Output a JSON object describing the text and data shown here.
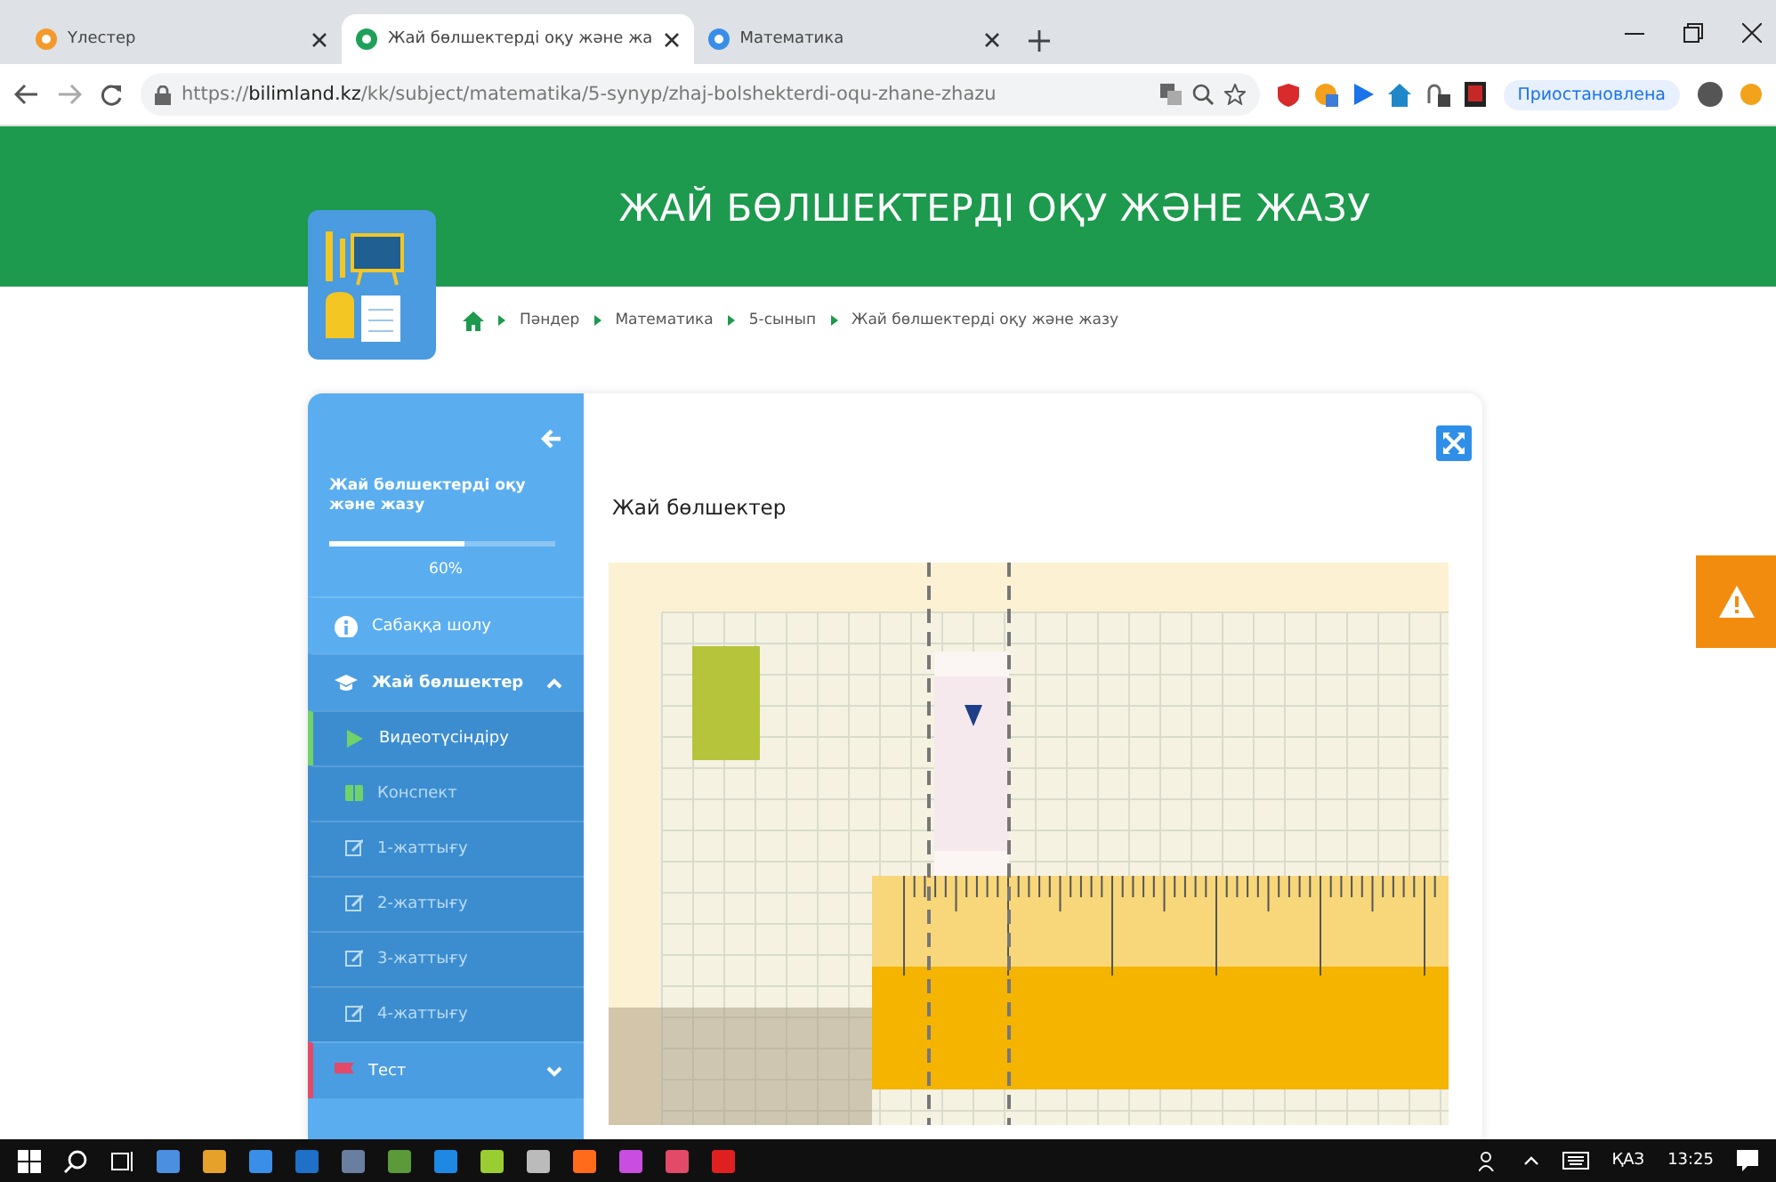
{
  "browser": {
    "tabs": [
      {
        "title": "Үлестер",
        "selected": false
      },
      {
        "title": "Жай бөлшектерді оқу және жа",
        "selected": true
      },
      {
        "title": "Математика",
        "selected": false
      }
    ],
    "url": {
      "prefix": "https://",
      "domain": "bilimland.kz",
      "path": "/kk/subject/matematika/5-synyp/zhaj-bolshekterdi-oqu-zhane-zhazu"
    },
    "profile_label": "Приостановлена"
  },
  "page": {
    "title": "ЖАЙ БӨЛШЕКТЕРДІ ОҚУ ЖӘНЕ ЖАЗУ",
    "breadcrumbs": [
      "Пәндер",
      "Математика",
      "5-сынып",
      "Жай бөлшектерді оқу және жазу"
    ],
    "sidebar": {
      "lesson_title": "Жай бөлшектерді оқу және жазу",
      "progress": {
        "level": 0.6,
        "reading": "60%"
      },
      "items": [
        {
          "label": "Сабаққа шолу",
          "kind": "info"
        },
        {
          "label": "Жай бөлшектер",
          "kind": "section",
          "expanded": true,
          "children": [
            {
              "label": "Видеотүсіндіру",
              "kind": "video",
              "selected": true
            },
            {
              "label": "Конспект",
              "kind": "notes",
              "selected": false
            },
            {
              "label": "1-жаттығу",
              "kind": "exercise",
              "selected": false
            },
            {
              "label": "2-жаттығу",
              "kind": "exercise",
              "selected": false
            },
            {
              "label": "3-жаттығу",
              "kind": "exercise",
              "selected": false
            },
            {
              "label": "4-жаттығу",
              "kind": "exercise",
              "selected": false
            }
          ]
        },
        {
          "label": "Тест",
          "kind": "test",
          "expanded": false
        }
      ]
    },
    "content": {
      "heading": "Жай бөлшектер"
    }
  },
  "taskbar": {
    "language": "ҚАЗ",
    "time": "13:25"
  }
}
